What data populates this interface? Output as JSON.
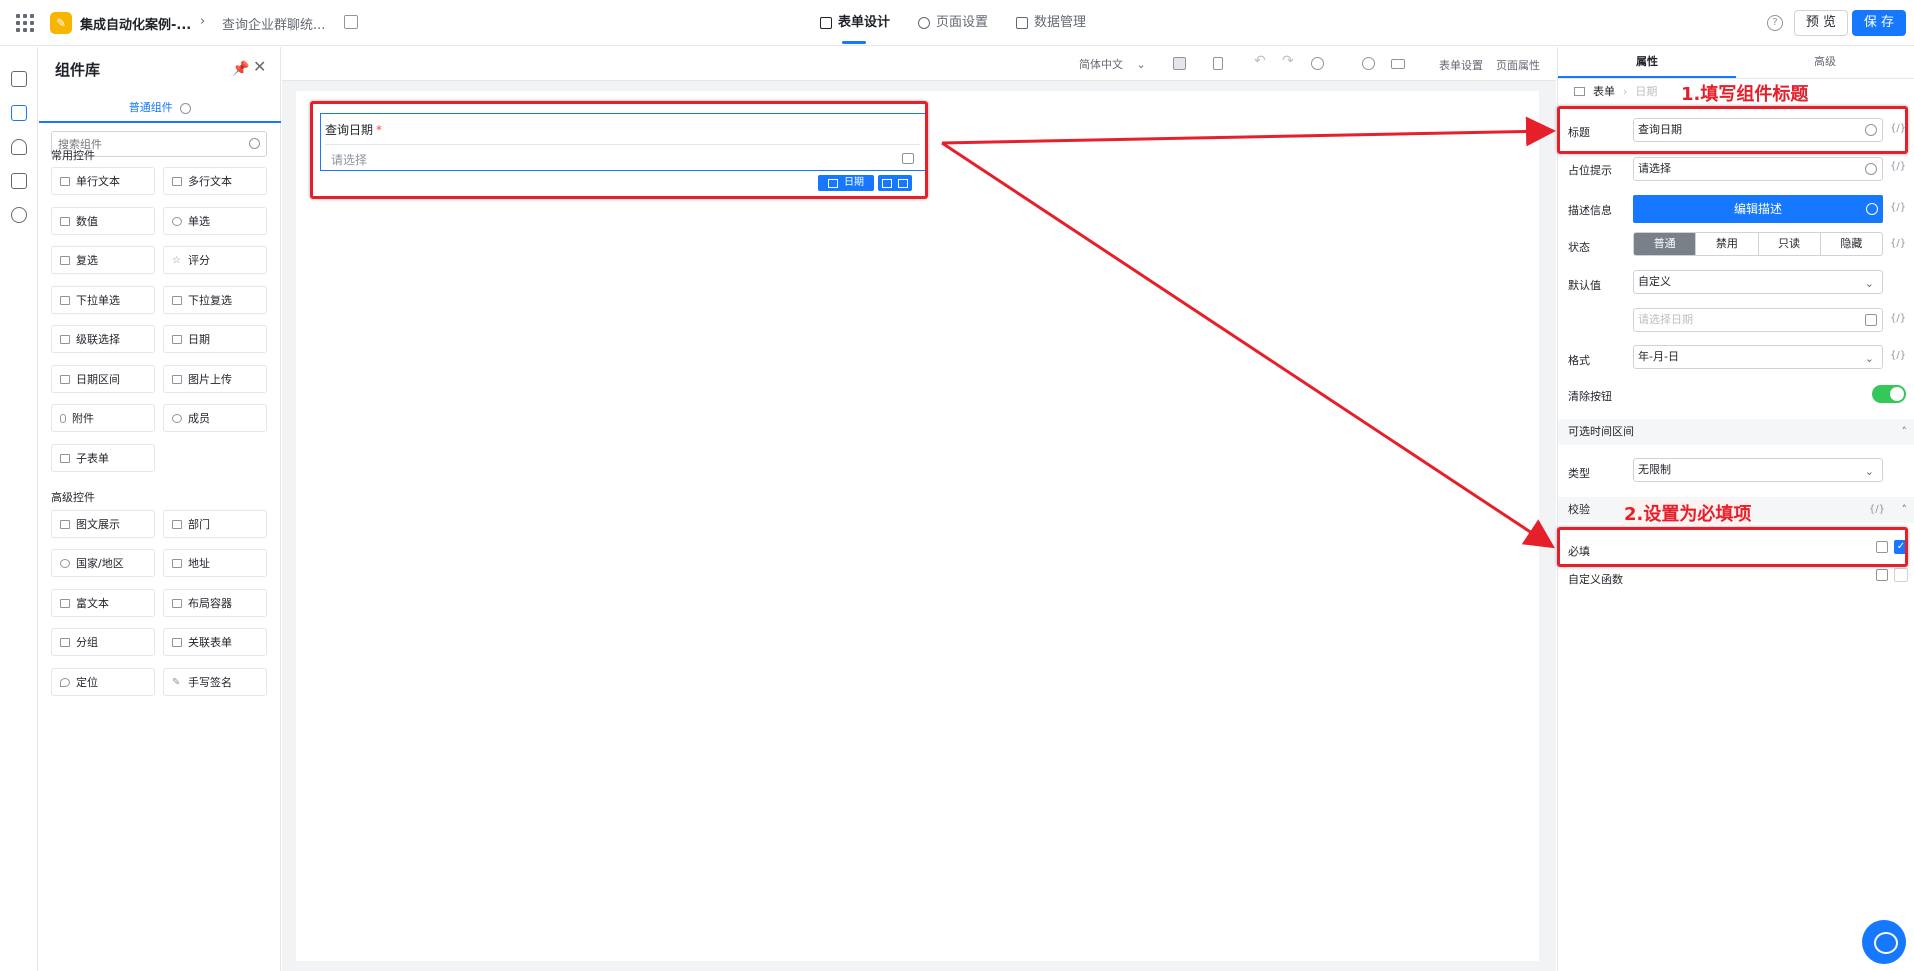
{
  "header": {
    "app_logo": "✎",
    "app_name": "集成自动化案例-...",
    "page_name": "查询企业群聊统...",
    "tabs": [
      {
        "label": "表单设计"
      },
      {
        "label": "页面设置"
      },
      {
        "label": "数据管理"
      }
    ],
    "help": "?",
    "preview_label": "预 览",
    "save_label": "保 存"
  },
  "component_library": {
    "title": "组件库",
    "tab": "普通组件",
    "search_placeholder": "搜索组件",
    "common_group_title": "常用控件",
    "common": [
      "单行文本",
      "多行文本",
      "数值",
      "单选",
      "复选",
      "评分",
      "下拉单选",
      "下拉复选",
      "级联选择",
      "日期",
      "日期区间",
      "图片上传",
      "附件",
      "成员",
      "子表单"
    ],
    "advanced_group_title": "高级控件",
    "advanced": [
      "图文展示",
      "部门",
      "国家/地区",
      "地址",
      "富文本",
      "布局容器",
      "分组",
      "关联表单",
      "定位",
      "手写签名"
    ]
  },
  "toolbar": {
    "language": "简体中文",
    "form_settings": "表单设置",
    "page_properties": "页面属性"
  },
  "canvas": {
    "field_label": "查询日期",
    "required_mark": "*",
    "field_placeholder": "请选择",
    "type_badge": "日期"
  },
  "right_panel": {
    "tabs": [
      "属性",
      "高级"
    ],
    "crumb_root": "表单",
    "crumb_current": "日期",
    "title_label": "标题",
    "title_value": "查询日期",
    "placeholder_label": "占位提示",
    "placeholder_value": "请选择",
    "description_label": "描述信息",
    "description_button": "编辑描述",
    "status_label": "状态",
    "status_options": [
      "普通",
      "禁用",
      "只读",
      "隐藏"
    ],
    "default_label": "默认值",
    "default_value": "自定义",
    "date_placeholder": "请选择日期",
    "format_label": "格式",
    "format_value": "年-月-日",
    "clear_label": "清除按钮",
    "range_section": "可选时间区间",
    "type_label": "类型",
    "type_value": "无限制",
    "validation_section": "校验",
    "required_label": "必填",
    "custom_fn_label": "自定义函数",
    "fx": "{/}"
  },
  "annotations": {
    "step1": "1.填写组件标题",
    "step2": "2.设置为必填项"
  },
  "colors": {
    "primary": "#1677ff",
    "annotation": "#e6202b",
    "toggle_on": "#34c759"
  }
}
